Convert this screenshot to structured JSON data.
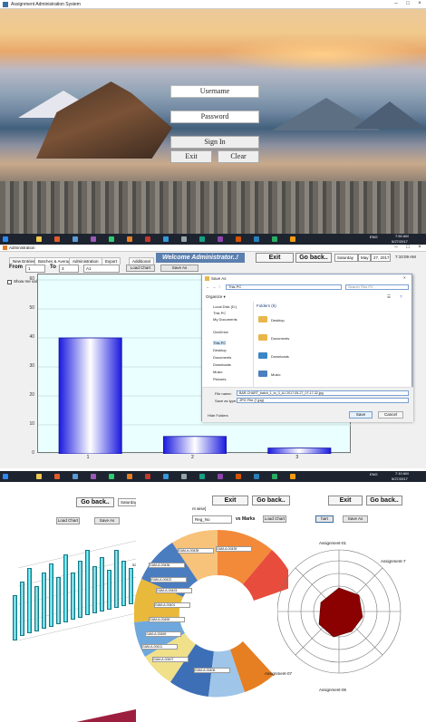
{
  "login_window": {
    "title": "Assignment Administration System",
    "username_label": "Username",
    "password_label": "Password",
    "signin_label": "Sign In",
    "exit_label": "Exit",
    "clear_label": "Clear"
  },
  "taskbar_top": {
    "time": "7:50 AM",
    "date": "5/27/2017",
    "lang": "ENG"
  },
  "admin_window": {
    "title": "Administration",
    "tabs": [
      "New Entries",
      "Batches & Average",
      "Administration",
      "Export",
      "Additional"
    ],
    "welcome": "Welcome Administrator..!",
    "exit_label": "Exit",
    "goback_label": "Go back..",
    "date": {
      "day": "Saturday",
      "month": "May",
      "num": "27, 2017"
    },
    "time": "7:10:09 AM",
    "from_label": "From",
    "to_label": "To",
    "from_value": "1",
    "to_value": "3",
    "batch_value": "A1",
    "load_chart": "Load Chart",
    "save_as": "Save As",
    "show_values": "Show me values"
  },
  "chart_data": {
    "type": "bar",
    "categories": [
      "1",
      "2",
      "3"
    ],
    "values": [
      40,
      6,
      2
    ],
    "ylim": [
      0,
      60
    ],
    "yticks": [
      0,
      10,
      20,
      30,
      40,
      50,
      60
    ],
    "grid": true
  },
  "save_dialog": {
    "title": "Save As",
    "breadcrumb": "This PC",
    "search_placeholder": "Search This PC",
    "organize": "Organize ▾",
    "nav_items": [
      "Local Disk (D:)",
      "This PC",
      "My Documents",
      "OneDrive",
      "This PC",
      "Desktop",
      "Documents",
      "Downloads",
      "Music",
      "Pictures"
    ],
    "folders_header": "Folders (6)",
    "folders": [
      "Desktop",
      "Documents",
      "Downloads",
      "Music"
    ],
    "filename_label": "File name:",
    "filename_value": "BAR-CHART_batch_1_to_3_A1 2017-05-27_07-17-32.jpg",
    "type_label": "Save as type:",
    "type_value": "JPG File (*.jpg)",
    "hide_folders": "Hide Folders",
    "save_btn": "Save",
    "cancel_btn": "Cancel"
  },
  "taskbar_bottom": {
    "time": "7:10 AM",
    "date": "5/27/2017",
    "lang": "ENG"
  },
  "collage": {
    "left_goback": "Go back..",
    "left_day": "Saturday",
    "left_month": "May",
    "left_num": "27",
    "left_load": "Load Chart",
    "left_save": "Save As",
    "left_value_labels": [
      "52"
    ],
    "mid_exit": "Exit",
    "mid_goback": "Go back..",
    "mid_select": "Reg_No",
    "mid_vs": "vs Marks",
    "mid_load": "Load Chart",
    "mid_wise": "nt wise]",
    "donut_labels": [
      "GAM-A-00436",
      "GAM-A-00435",
      "GAM-A-00439",
      "GAM-A-00422",
      "GAM-A-00423",
      "GAM-A-00401",
      "GAM-A-00455",
      "GAM-A-00469",
      "GAM-A-00411",
      "GAM-A-00407",
      "GAM-A-00406",
      "GAM-A-00401",
      "GAM-A-00409",
      "GAM-A-00403",
      "GAM-A-00402"
    ],
    "right_exit": "Exit",
    "right_goback": "Go back..",
    "right_load": "hart",
    "right_save": "Save As",
    "radar_labels": [
      "Assignment-01",
      "Assignment-7",
      "Assignment-07",
      "Assignment-06"
    ]
  },
  "colors": {
    "accent": "#5b7fae",
    "bar": "#1a1adf",
    "radar_fill": "#8b0000",
    "collage_bg": "#9d1f3f"
  }
}
